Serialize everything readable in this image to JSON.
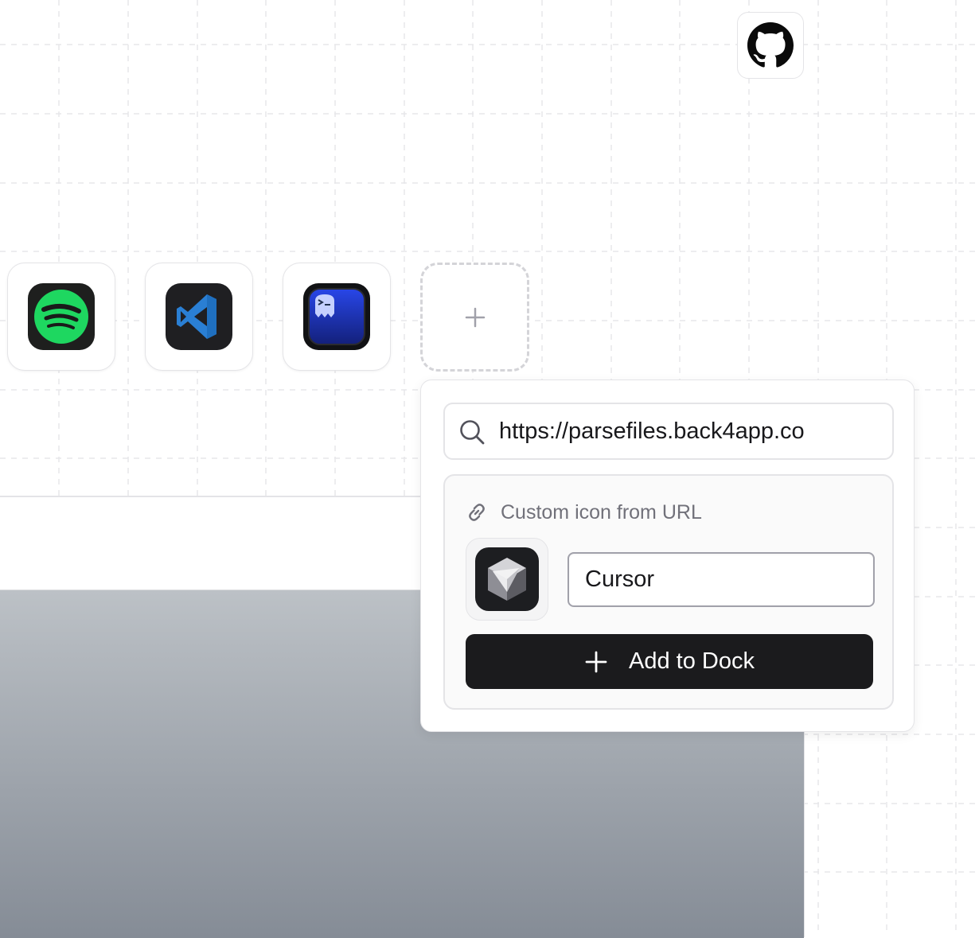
{
  "colors": {
    "background": "#ffffff",
    "grid_line": "#e7e7ea",
    "tile_border": "#e4e4e7",
    "button_bg": "#1b1b1d",
    "muted_text": "#71717a",
    "spotify_green": "#1ed760",
    "vscode_blue": "#2a7fd4",
    "ghostty_blue": "#1f3fd6"
  },
  "icons": {
    "top_right": "github-icon",
    "dock_apps": [
      "spotify-icon",
      "vscode-icon",
      "ghostty-icon"
    ],
    "add_slot": "plus-icon"
  },
  "popover": {
    "search": {
      "value": "https://parsefiles.back4app.co",
      "icon": "search-icon"
    },
    "custom": {
      "title": "Custom icon from URL",
      "icon": "link-icon",
      "preview_icon": "cursor-app-icon",
      "name_value": "Cursor",
      "add_label": "Add to Dock"
    }
  }
}
